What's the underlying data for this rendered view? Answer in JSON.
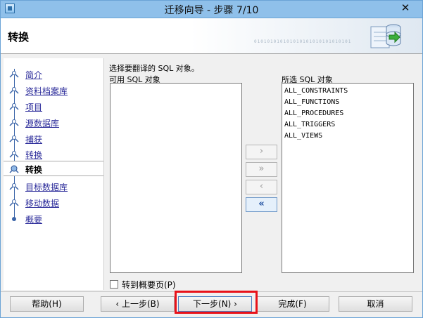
{
  "window": {
    "title": "迁移向导 - 步骤 7/10",
    "close_glyph": "✕"
  },
  "banner": {
    "title": "转换",
    "binary_text": "010101010101010101010101010101"
  },
  "nav": {
    "items": [
      {
        "label": "简介",
        "state": "link"
      },
      {
        "label": "资料档案库",
        "state": "link"
      },
      {
        "label": "项目",
        "state": "link"
      },
      {
        "label": "源数据库",
        "state": "link"
      },
      {
        "label": "捕获",
        "state": "link"
      },
      {
        "label": "转换",
        "state": "link"
      },
      {
        "label": "转换",
        "state": "current"
      },
      {
        "label": "目标数据库",
        "state": "link"
      },
      {
        "label": "移动数据",
        "state": "link"
      },
      {
        "label": "概要",
        "state": "link"
      }
    ]
  },
  "main": {
    "instruction": "选择要翻译的 SQL 对象。",
    "available_label": "可用 SQL 对象",
    "selected_label": "所选 SQL 对象",
    "available_items": [],
    "selected_items": [
      "ALL_CONSTRAINTS",
      "ALL_FUNCTIONS",
      "ALL_PROCEDURES",
      "ALL_TRIGGERS",
      "ALL_VIEWS"
    ],
    "move_buttons": {
      "move_right": "›",
      "move_all_right": "»",
      "move_left": "‹",
      "move_all_left": "«"
    },
    "checkbox_label": "转到概要页(P)"
  },
  "footer": {
    "help": "帮助(H)",
    "back": "‹ 上一步(B)",
    "next": "下一步(N) ›",
    "finish": "完成(F)",
    "cancel": "取消"
  },
  "colors": {
    "titlebar": "#8fc0ea",
    "link": "#2b2b9a",
    "highlight": "#e8121a"
  }
}
